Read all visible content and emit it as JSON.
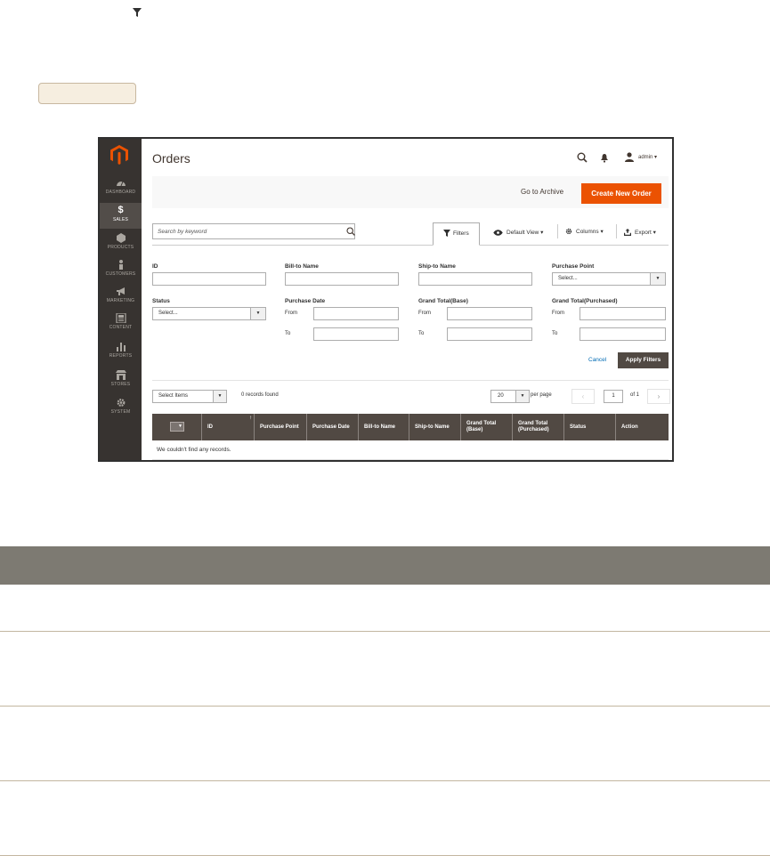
{
  "app": {
    "page_title": "Orders",
    "user_name": "admin",
    "sidebar": [
      {
        "label": "DASHBOARD",
        "icon": "dashboard-icon"
      },
      {
        "label": "SALES",
        "icon": "dollar-icon",
        "active": true
      },
      {
        "label": "PRODUCTS",
        "icon": "cube-icon"
      },
      {
        "label": "CUSTOMERS",
        "icon": "person-icon"
      },
      {
        "label": "MARKETING",
        "icon": "megaphone-icon"
      },
      {
        "label": "CONTENT",
        "icon": "content-icon"
      },
      {
        "label": "REPORTS",
        "icon": "bar-chart-icon"
      },
      {
        "label": "STORES",
        "icon": "store-icon"
      },
      {
        "label": "SYSTEM",
        "icon": "gear-icon"
      }
    ],
    "toolbar": {
      "archive_label": "Go to Archive",
      "create_label": "Create New Order"
    },
    "search": {
      "placeholder": "Search by keyword"
    },
    "controls": {
      "filters": "Filters",
      "view": "Default View",
      "columns": "Columns",
      "export": "Export"
    },
    "filters": {
      "id": "ID",
      "bill_to": "Bill-to Name",
      "ship_to": "Ship-to Name",
      "purchase_point": "Purchase Point",
      "purchase_point_value": "Select...",
      "status": "Status",
      "status_value": "Select...",
      "purchase_date": "Purchase Date",
      "grand_total_base": "Grand Total(Base)",
      "grand_total_purchased": "Grand Total(Purchased)",
      "from": "From",
      "to": "To",
      "cancel": "Cancel",
      "apply": "Apply Filters"
    },
    "grid": {
      "mass_action": "Select Items",
      "records_found": "0 records found",
      "per_page_value": "20",
      "per_page_label": "per page",
      "page_value": "1",
      "page_of": "of 1",
      "prev": "‹",
      "next": "›",
      "columns": [
        "ID",
        "Purchase Point",
        "Purchase Date",
        "Bill-to Name",
        "Ship-to Name",
        "Grand Total (Base)",
        "Grand Total (Purchased)",
        "Status",
        "Action"
      ],
      "empty_message": "We couldn't find any records."
    }
  },
  "colors": {
    "accent": "#eb5202",
    "sidebar_bg": "#373330",
    "grid_header": "#514943",
    "doc_table_header": "#7d7a72"
  }
}
